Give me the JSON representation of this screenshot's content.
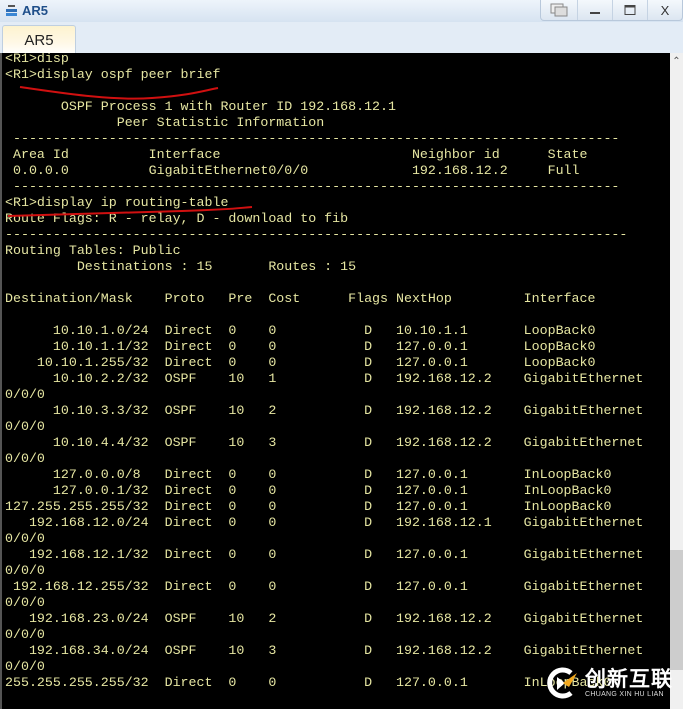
{
  "window": {
    "title": "AR5",
    "controls": [
      "restore-windows",
      "minimize",
      "maximize",
      "close"
    ],
    "close_label": "X"
  },
  "tabs": [
    {
      "label": "AR5",
      "active": true
    }
  ],
  "terminal": {
    "text_color": "#e6e6a2",
    "background": "#000000",
    "lines": [
      "<R1>disp",
      "<R1>display ospf peer brief",
      "",
      "       OSPF Process 1 with Router ID 192.168.12.1",
      "              Peer Statistic Information",
      " ----------------------------------------------------------------------------",
      " Area Id          Interface                        Neighbor id      State",
      " 0.0.0.0          GigabitEthernet0/0/0             192.168.12.2     Full",
      " ----------------------------------------------------------------------------",
      "<R1>display ip routing-table",
      "Route Flags: R - relay, D - download to fib",
      "------------------------------------------------------------------------------",
      "Routing Tables: Public",
      "         Destinations : 15       Routes : 15",
      "",
      "Destination/Mask    Proto   Pre  Cost      Flags NextHop         Interface",
      "",
      "      10.10.1.0/24  Direct  0    0           D   10.10.1.1       LoopBack0",
      "      10.10.1.1/32  Direct  0    0           D   127.0.0.1       LoopBack0",
      "    10.10.1.255/32  Direct  0    0           D   127.0.0.1       LoopBack0",
      "      10.10.2.2/32  OSPF    10   1           D   192.168.12.2    GigabitEthernet",
      "0/0/0",
      "      10.10.3.3/32  OSPF    10   2           D   192.168.12.2    GigabitEthernet",
      "0/0/0",
      "      10.10.4.4/32  OSPF    10   3           D   192.168.12.2    GigabitEthernet",
      "0/0/0",
      "      127.0.0.0/8   Direct  0    0           D   127.0.0.1       InLoopBack0",
      "      127.0.0.1/32  Direct  0    0           D   127.0.0.1       InLoopBack0",
      "127.255.255.255/32  Direct  0    0           D   127.0.0.1       InLoopBack0",
      "   192.168.12.0/24  Direct  0    0           D   192.168.12.1    GigabitEthernet",
      "0/0/0",
      "   192.168.12.1/32  Direct  0    0           D   127.0.0.1       GigabitEthernet",
      "0/0/0",
      " 192.168.12.255/32  Direct  0    0           D   127.0.0.1       GigabitEthernet",
      "0/0/0",
      "   192.168.23.0/24  OSPF    10   2           D   192.168.12.2    GigabitEthernet",
      "0/0/0",
      "   192.168.34.0/24  OSPF    10   3           D   192.168.12.2    GigabitEthernet",
      "0/0/0",
      "255.255.255.255/32  Direct  0    0           D   127.0.0.1       InLoopBack0"
    ]
  },
  "ospf_peer": {
    "process_line": "OSPF Process 1 with Router ID 192.168.12.1",
    "subtitle": "Peer Statistic Information",
    "headers": [
      "Area Id",
      "Interface",
      "Neighbor id",
      "State"
    ],
    "rows": [
      [
        "0.0.0.0",
        "GigabitEthernet0/0/0",
        "192.168.12.2",
        "Full"
      ]
    ]
  },
  "routing_table": {
    "flags_legend": "Route Flags: R - relay, D - download to fib",
    "table_name": "Routing Tables: Public",
    "destinations": 15,
    "routes": 15,
    "headers": [
      "Destination/Mask",
      "Proto",
      "Pre",
      "Cost",
      "Flags",
      "NextHop",
      "Interface"
    ],
    "rows": [
      [
        "10.10.1.0/24",
        "Direct",
        "0",
        "0",
        "D",
        "10.10.1.1",
        "LoopBack0"
      ],
      [
        "10.10.1.1/32",
        "Direct",
        "0",
        "0",
        "D",
        "127.0.0.1",
        "LoopBack0"
      ],
      [
        "10.10.1.255/32",
        "Direct",
        "0",
        "0",
        "D",
        "127.0.0.1",
        "LoopBack0"
      ],
      [
        "10.10.2.2/32",
        "OSPF",
        "10",
        "1",
        "D",
        "192.168.12.2",
        "GigabitEthernet0/0/0"
      ],
      [
        "10.10.3.3/32",
        "OSPF",
        "10",
        "2",
        "D",
        "192.168.12.2",
        "GigabitEthernet0/0/0"
      ],
      [
        "10.10.4.4/32",
        "OSPF",
        "10",
        "3",
        "D",
        "192.168.12.2",
        "GigabitEthernet0/0/0"
      ],
      [
        "127.0.0.0/8",
        "Direct",
        "0",
        "0",
        "D",
        "127.0.0.1",
        "InLoopBack0"
      ],
      [
        "127.0.0.1/32",
        "Direct",
        "0",
        "0",
        "D",
        "127.0.0.1",
        "InLoopBack0"
      ],
      [
        "127.255.255.255/32",
        "Direct",
        "0",
        "0",
        "D",
        "127.0.0.1",
        "InLoopBack0"
      ],
      [
        "192.168.12.0/24",
        "Direct",
        "0",
        "0",
        "D",
        "192.168.12.1",
        "GigabitEthernet0/0/0"
      ],
      [
        "192.168.12.1/32",
        "Direct",
        "0",
        "0",
        "D",
        "127.0.0.1",
        "GigabitEthernet0/0/0"
      ],
      [
        "192.168.12.255/32",
        "Direct",
        "0",
        "0",
        "D",
        "127.0.0.1",
        "GigabitEthernet0/0/0"
      ],
      [
        "192.168.23.0/24",
        "OSPF",
        "10",
        "2",
        "D",
        "192.168.12.2",
        "GigabitEthernet0/0/0"
      ],
      [
        "192.168.34.0/24",
        "OSPF",
        "10",
        "3",
        "D",
        "192.168.12.2",
        "GigabitEthernet0/0/0"
      ],
      [
        "255.255.255.255/32",
        "Direct",
        "0",
        "0",
        "D",
        "127.0.0.1",
        "InLoopBack0"
      ]
    ]
  },
  "annotations": {
    "color": "#d01010",
    "marks": [
      "underline under 'display ospf peer brief'",
      "underline under 'display ip routing-table'"
    ]
  },
  "watermark": {
    "chinese": "创新互联",
    "pinyin": "CHUANG XIN HU LIAN"
  },
  "scrollbar": {
    "position_fraction": 0.78
  }
}
